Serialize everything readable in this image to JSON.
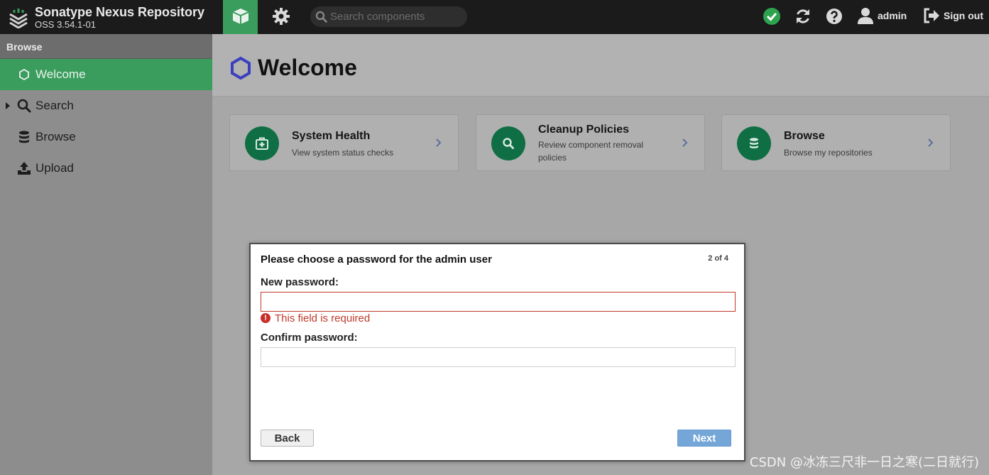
{
  "header": {
    "product_name": "Sonatype Nexus Repository",
    "version": "OSS 3.54.1-01",
    "search_placeholder": "Search components",
    "user_name": "admin",
    "signout_label": "Sign out",
    "icons": [
      "nexus-logo-icon",
      "cube-icon",
      "gear-icon",
      "search-icon",
      "status-ok-icon",
      "refresh-icon",
      "help-icon",
      "user-icon",
      "signout-icon"
    ]
  },
  "sidebar": {
    "header": "Browse",
    "items": [
      {
        "label": "Welcome",
        "icon": "hexagon-icon",
        "active": true
      },
      {
        "label": "Search",
        "icon": "search-icon",
        "expandable": true
      },
      {
        "label": "Browse",
        "icon": "database-icon"
      },
      {
        "label": "Upload",
        "icon": "upload-icon"
      }
    ]
  },
  "main": {
    "title": "Welcome",
    "cards": [
      {
        "title": "System Health",
        "description": "View system status checks",
        "icon": "medkit-icon"
      },
      {
        "title": "Cleanup Policies",
        "description": "Review component removal policies",
        "icon": "search-icon"
      },
      {
        "title": "Browse",
        "description": "Browse my repositories",
        "icon": "database-icon"
      }
    ]
  },
  "dialog": {
    "title": "Please choose a password for the admin user",
    "step": "2 of 4",
    "new_password_label": "New password:",
    "new_password_value": "",
    "error_text": "This field is required",
    "confirm_password_label": "Confirm password:",
    "confirm_password_value": "",
    "back_label": "Back",
    "next_label": "Next"
  },
  "watermark": "CSDN @冰冻三尺非一日之寒(二日就行)",
  "colors": {
    "accent_green": "#3a9d5d",
    "card_icon_green": "#0f6e43",
    "error_red": "#c0392b",
    "next_button_blue": "#74a6d8"
  }
}
